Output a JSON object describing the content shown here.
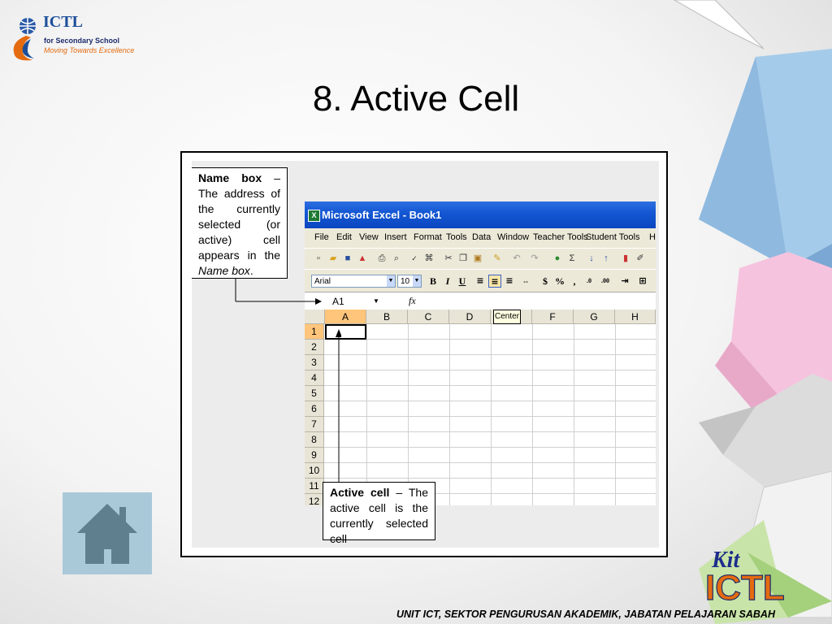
{
  "logo": {
    "title": "ICTL",
    "subtitle": "for Secondary School",
    "motto": "Moving Towards Excellence"
  },
  "slide": {
    "title": "8. Active Cell"
  },
  "excel": {
    "window_title": "Microsoft Excel - Book1",
    "menu": [
      "File",
      "Edit",
      "View",
      "Insert",
      "Format",
      "Tools",
      "Data",
      "Window",
      "Teacher Tools",
      "Student Tools",
      "H"
    ],
    "font_name": "Arial",
    "font_size": "10",
    "name_box": "A1",
    "fx_label": "fx",
    "columns": [
      "A",
      "B",
      "C",
      "D",
      "E",
      "F",
      "G",
      "H"
    ],
    "rows": [
      "1",
      "2",
      "3",
      "4",
      "5",
      "6",
      "7",
      "8",
      "9",
      "10",
      "11",
      "12"
    ],
    "active_cell": "A1",
    "tooltip": "Center"
  },
  "callouts": {
    "name_box": {
      "term": "Name box",
      "text": " – The address of the currently selected (or active) cell appears in the ",
      "term_italic": "Name box",
      "end": "."
    },
    "active_cell": {
      "term": "Active cell",
      "text": " – The active cell is the currently selected cell"
    }
  },
  "branding": {
    "kit_label": "Kit",
    "ictl_label": "ICTL"
  },
  "footer": {
    "text": "UNIT ICT, SEKTOR PENGURUSAN AKADEMIK, JABATAN PELAJARAN SABAH"
  },
  "colors": {
    "title_bar": "#1458d4",
    "active_header": "#ffc57b",
    "toolbar_bg": "#ece9d8",
    "home_button": "#a9c9d9"
  }
}
